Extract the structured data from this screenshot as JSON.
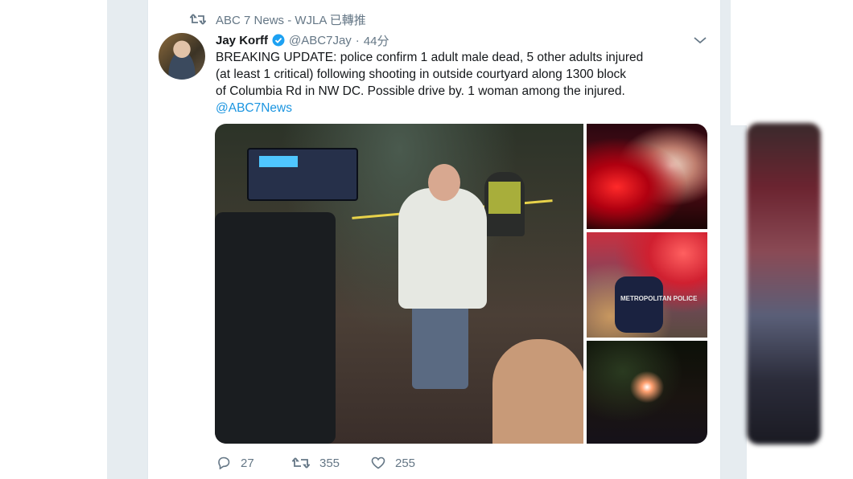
{
  "retweet_context": {
    "text": "ABC 7 News - WJLA 已轉推",
    "icon": "retweet-icon"
  },
  "tweet": {
    "display_name": "Jay Korff",
    "handle": "@ABC7Jay",
    "separator": "·",
    "time": "44分",
    "verified": true,
    "menu_icon": "chevron-down-icon",
    "text_lines": [
      "BREAKING UPDATE: police confirm 1 adult male dead, 5 other adults injured",
      "(at least 1 critical) following shooting in outside courtyard along 1300 block",
      "of Columbia Rd in NW DC. Possible drive by. 1 woman among the injured."
    ],
    "mention": "@ABC7News",
    "media": {
      "police_label": "METROPOLITAN POLICE"
    },
    "actions": {
      "replies": "27",
      "retweets": "355",
      "likes": "255"
    }
  },
  "colors": {
    "link": "#1b95e0",
    "secondary_text": "#657786",
    "primary_text": "#14171a",
    "verified": "#1da1f2",
    "page_background": "#e6ecf0"
  }
}
